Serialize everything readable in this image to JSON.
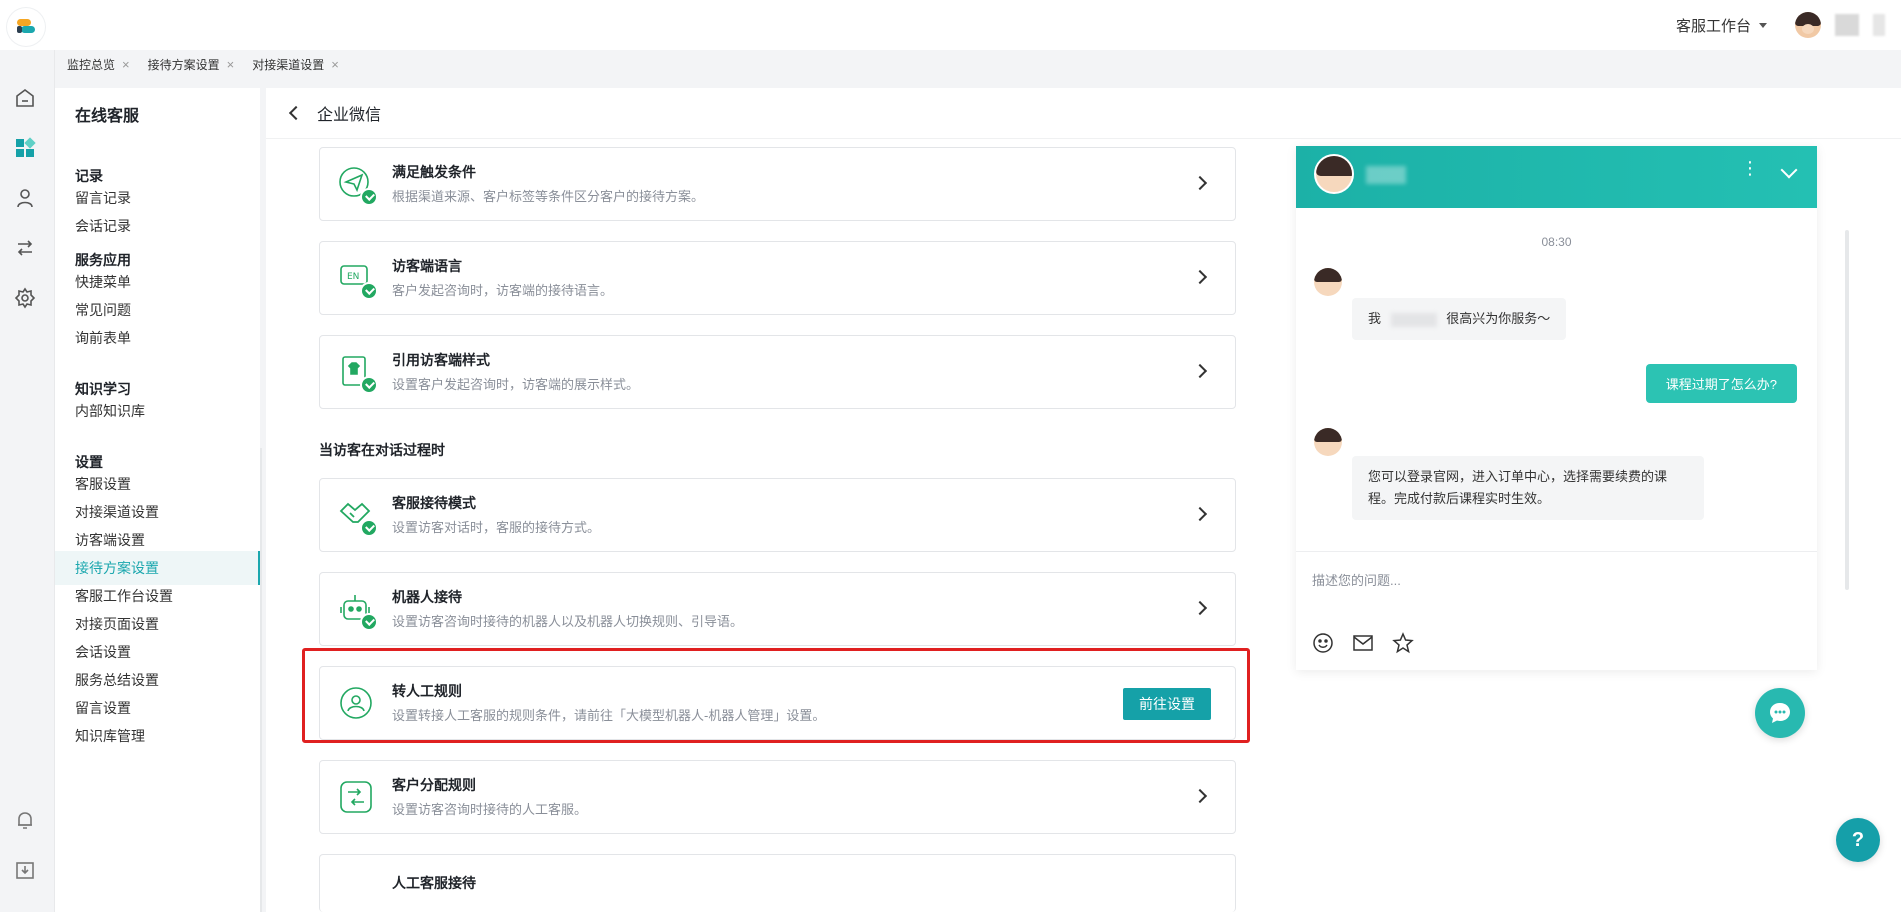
{
  "header": {
    "workspace_label": "客服工作台"
  },
  "tabs": [
    {
      "label": "监控总览",
      "close": "×"
    },
    {
      "label": "接待方案设置",
      "close": "×"
    },
    {
      "label": "对接渠道设置",
      "close": "×"
    }
  ],
  "sidebar": {
    "title": "在线客服",
    "groups": [
      {
        "label": "记录",
        "items": [
          "留言记录",
          "会话记录"
        ]
      },
      {
        "label": "服务应用",
        "items": [
          "快捷菜单",
          "常见问题",
          "询前表单"
        ]
      },
      {
        "label": "知识学习",
        "items": [
          "内部知识库"
        ]
      },
      {
        "label": "设置",
        "items": [
          "客服设置",
          "对接渠道设置",
          "访客端设置",
          "接待方案设置",
          "客服工作台设置",
          "对接页面设置",
          "会话设置",
          "服务总结设置",
          "留言设置",
          "知识库管理"
        ]
      }
    ],
    "active_item": "接待方案设置"
  },
  "main": {
    "page_title": "企业微信",
    "section_label": "当访客在对话过程时",
    "cards": [
      {
        "title": "满足触发条件",
        "desc": "根据渠道来源、客户标签等条件区分客户的接待方案。"
      },
      {
        "title": "访客端语言",
        "desc": "客户发起咨询时，访客端的接待语言。"
      },
      {
        "title": "引用访客端样式",
        "desc": "设置客户发起咨询时，访客端的展示样式。"
      },
      {
        "title": "客服接待模式",
        "desc": "设置访客对话时，客服的接待方式。"
      },
      {
        "title": "机器人接待",
        "desc": "设置访客咨询时接待的机器人以及机器人切换规则、引导语。"
      },
      {
        "title": "转人工规则",
        "desc": "设置转接人工客服的规则条件，请前往「大模型机器人-机器人管理」设置。",
        "button": "前往设置"
      },
      {
        "title": "客户分配规则",
        "desc": "设置访客咨询时接待的人工客服。"
      },
      {
        "title": "人工客服接待",
        "desc": ""
      }
    ]
  },
  "preview": {
    "time": "08:30",
    "msg_greeting": "我",
    "msg_greeting_rest": "很高兴为你服务～",
    "msg_user": "课程过期了怎么办?",
    "msg_reply": "您可以登录官网，进入订单中心，选择需要续费的课程。完成付款后课程实时生效。",
    "input_placeholder": "描述您的问题..."
  },
  "help_icon_text": "?",
  "colors": {
    "accent": "#15a1a8",
    "highlight": "#e02020",
    "check": "#22a861"
  }
}
